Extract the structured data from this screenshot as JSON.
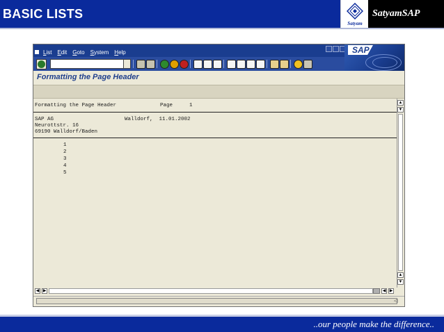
{
  "banner": {
    "title": "BASIC LISTS",
    "logo_sub": "Satyam",
    "brand": "SatyamSAP"
  },
  "sap_window": {
    "menu": [
      "List",
      "Edit",
      "Goto",
      "System",
      "Help"
    ],
    "menu_mnemonic": [
      "L",
      "E",
      "G",
      "S",
      "H"
    ],
    "sap_logo": "SAP",
    "screen_title": "Formatting the Page Header",
    "command_field_value": ""
  },
  "list": {
    "header_line": "Formatting the Page Header",
    "page_label": "Page",
    "page_number": "1",
    "company": "SAP AG",
    "city_date": "Walldorf,  11.01.2002",
    "street": "Neurottstr. 16",
    "zip_city": "69190 Walldorf/Baden",
    "numbers": [
      "1",
      "2",
      "3",
      "4",
      "5"
    ]
  },
  "footer": {
    "tagline": "..our people make the difference.."
  },
  "colors": {
    "banner_blue": "#0a2a9c",
    "sap_blue": "#1a3d8f",
    "sap_bg": "#ece9d8"
  }
}
